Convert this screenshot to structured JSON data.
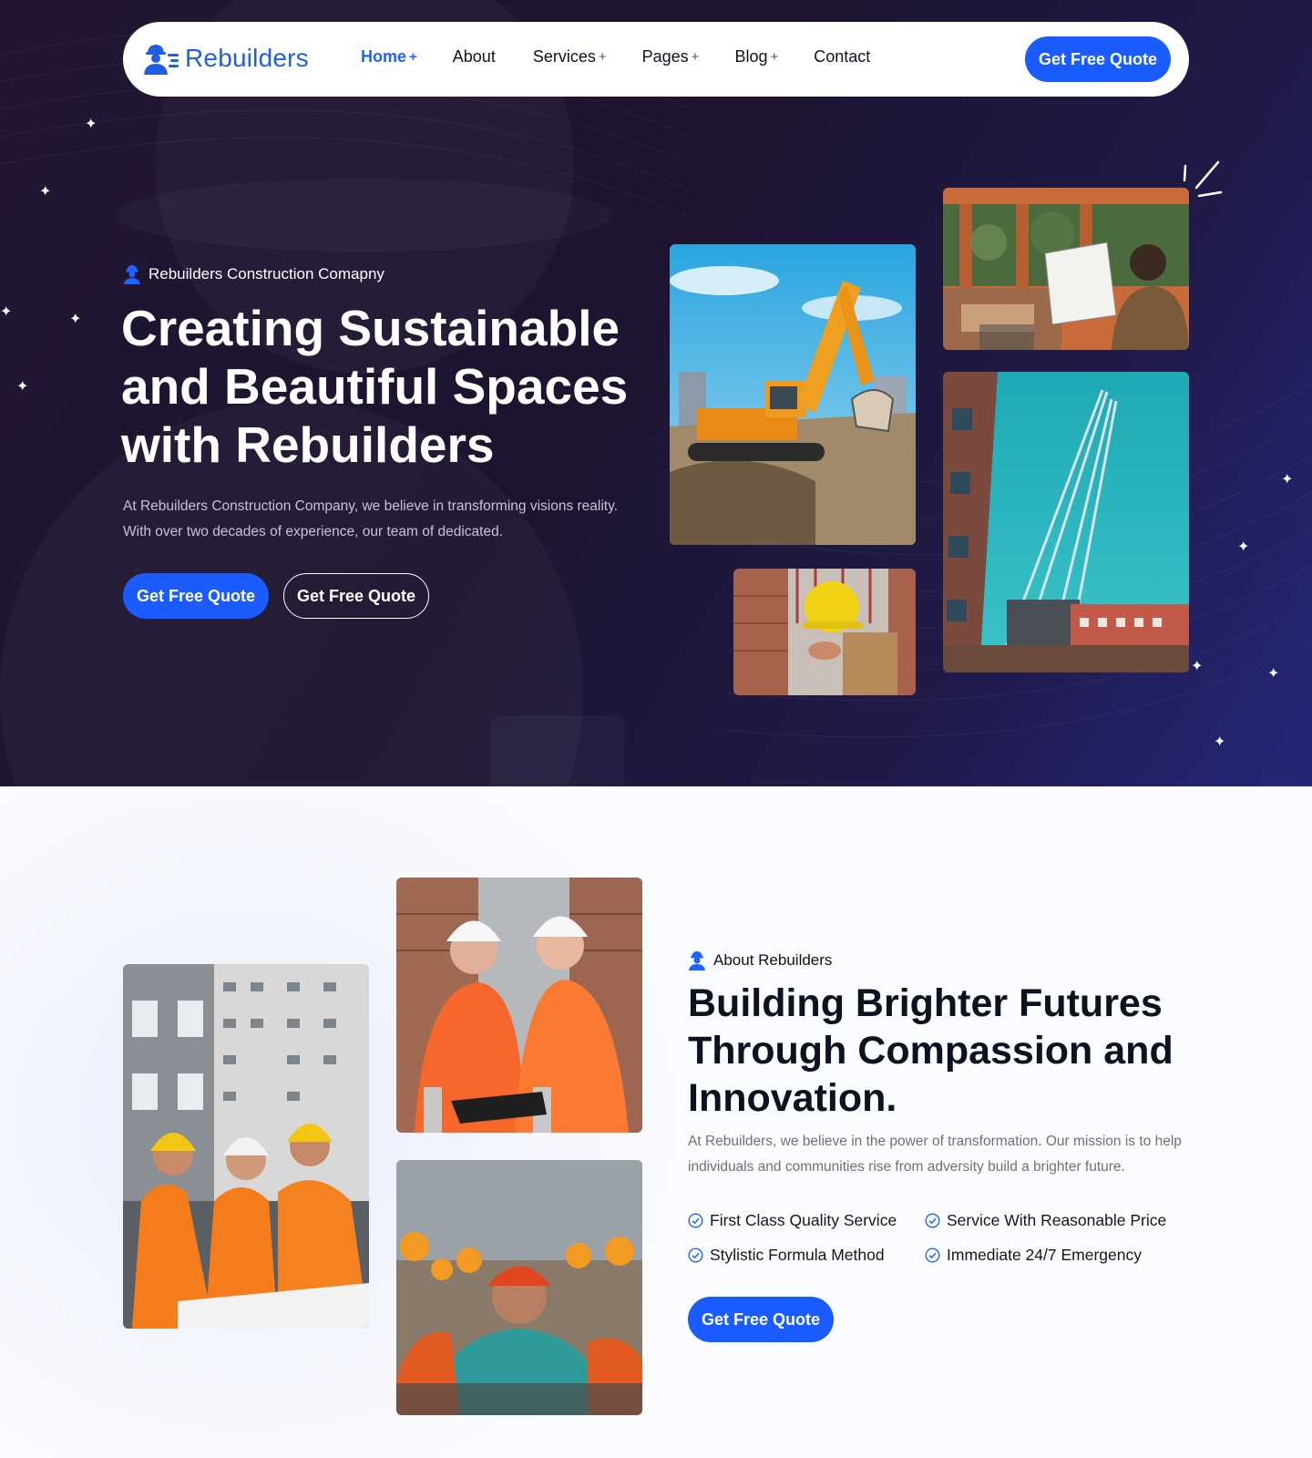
{
  "nav": {
    "logo_text": "Rebuilders",
    "items": [
      {
        "label": "Home",
        "has_submenu": true,
        "active": true
      },
      {
        "label": "About",
        "has_submenu": false,
        "active": false
      },
      {
        "label": "Services",
        "has_submenu": true,
        "active": false
      },
      {
        "label": "Pages",
        "has_submenu": true,
        "active": false
      },
      {
        "label": "Blog",
        "has_submenu": true,
        "active": false
      },
      {
        "label": "Contact",
        "has_submenu": false,
        "active": false
      }
    ],
    "submenu_marker": "+",
    "cta_label": "Get Free Quote"
  },
  "hero": {
    "eyebrow": "Rebuilders Construction Comapny",
    "title": "Creating Sustainable and Beautiful Spaces with Rebuilders",
    "description": "At Rebuilders Construction Company, we believe in transforming visions reality. With over two decades of experience, our team of dedicated.",
    "primary_button": "Get Free Quote",
    "secondary_button": "Get Free Quote",
    "images": [
      "excavator-photo",
      "architect-blueprint-photo",
      "construction-worker-helmet-photo",
      "tower-crane-photo"
    ]
  },
  "about": {
    "eyebrow": "About Rebuilders",
    "title": "Building Brighter Futures Through Compassion and Innovation.",
    "description": "At Rebuilders, we believe in the power of transformation. Our mission is to help individuals and communities rise from adversity build a brighter future.",
    "features": [
      "First Class Quality Service",
      "Service With Reasonable Price",
      "Stylistic Formula Method",
      "Immediate 24/7 Emergency"
    ],
    "button": "Get Free Quote",
    "images": [
      "engineers-team-photo",
      "engineers-thumbs-up-photo",
      "workers-crowd-photo"
    ]
  },
  "colors": {
    "brand_blue": "#1a5cff",
    "hero_bg": "#221632",
    "heading_dark": "#0f1020",
    "white": "#ffffff"
  }
}
